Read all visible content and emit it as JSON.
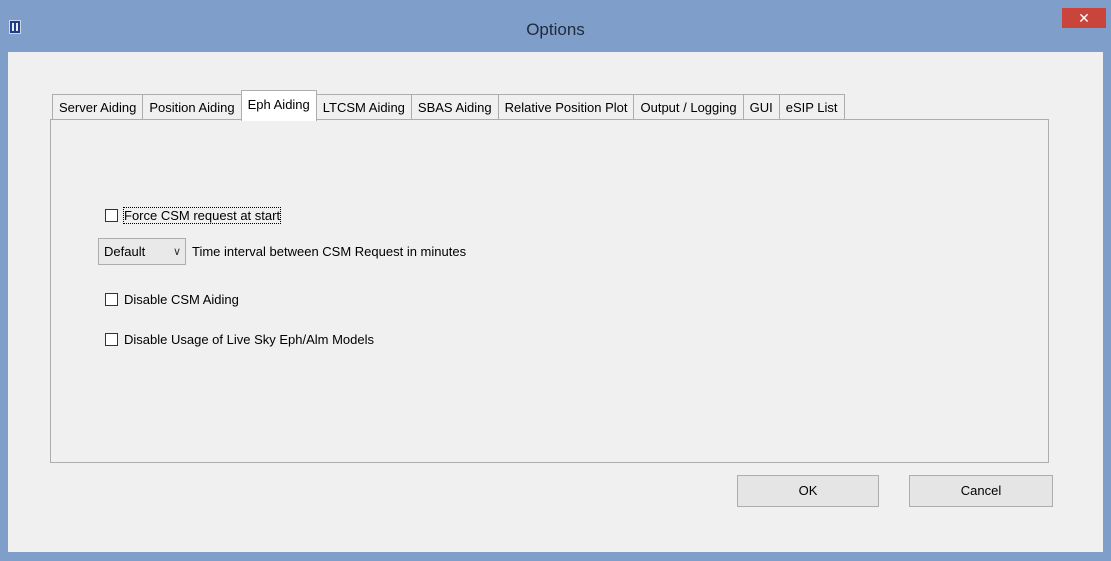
{
  "window": {
    "title": "Options",
    "close_glyph": "✕"
  },
  "tabs": [
    {
      "label": "Server Aiding",
      "active": false
    },
    {
      "label": "Position Aiding",
      "active": false
    },
    {
      "label": "Eph Aiding",
      "active": true
    },
    {
      "label": "LTCSM Aiding",
      "active": false
    },
    {
      "label": "SBAS Aiding",
      "active": false
    },
    {
      "label": "Relative Position Plot",
      "active": false
    },
    {
      "label": "Output / Logging",
      "active": false
    },
    {
      "label": "GUI",
      "active": false
    },
    {
      "label": "eSIP List",
      "active": false
    }
  ],
  "eph_aiding": {
    "force_csm": {
      "label": "Force CSM request at start",
      "checked": false
    },
    "interval": {
      "value": "Default",
      "label": "Time interval between CSM Request in minutes"
    },
    "disable_csm": {
      "label": "Disable CSM Aiding",
      "checked": false
    },
    "disable_live_sky": {
      "label": "Disable Usage of Live Sky Eph/Alm Models",
      "checked": false
    }
  },
  "buttons": {
    "ok": "OK",
    "cancel": "Cancel"
  },
  "icons": {
    "app": "app-icon",
    "close": "close-icon",
    "dropdown": "chevron-down-icon"
  },
  "colors": {
    "titlebar": "#7f9ec9",
    "close_button": "#c9443a",
    "dialog_bg": "#f0f0f0"
  }
}
